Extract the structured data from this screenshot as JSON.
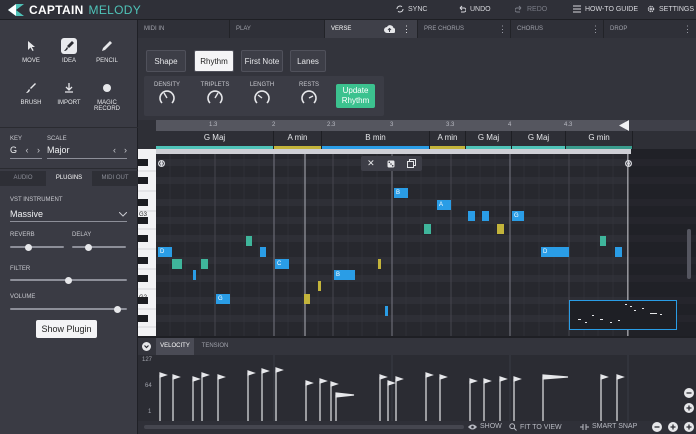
{
  "app": {
    "brand_bold": "CAPTAIN",
    "brand_light": "MELODY"
  },
  "topbar": {
    "sync": "SYNC",
    "undo": "UNDO",
    "redo": "REDO",
    "howto": "HOW-TO GUIDE",
    "settings": "SETTINGS"
  },
  "tools": [
    {
      "label": "MOVE",
      "icon": "cursor-icon"
    },
    {
      "label": "IDEA",
      "icon": "idea-brush-icon"
    },
    {
      "label": "PENCIL",
      "icon": "pencil-icon"
    },
    {
      "label": "BRUSH",
      "icon": "brush-icon"
    },
    {
      "label": "IMPORT",
      "icon": "download-icon"
    },
    {
      "label": "MAGIC",
      "label2": "RECORD",
      "icon": "record-dot-icon"
    }
  ],
  "key": {
    "label": "KEY",
    "value": "G"
  },
  "scale": {
    "label": "SCALE",
    "value": "Major"
  },
  "subtabs": [
    "AUDIO",
    "PLUGINS",
    "MIDI OUT"
  ],
  "plugin": {
    "vst_label": "VST INSTRUMENT",
    "vst_value": "Massive",
    "reverb": "REVERB",
    "delay": "DELAY",
    "filter": "FILTER",
    "volume": "VOLUME",
    "show": "Show Plugin",
    "reverb_level": 0.35,
    "delay_level": 0.3,
    "filter_level": 0.5,
    "volume_level": 0.92
  },
  "tabs": [
    "MIDI IN",
    "PLAY",
    "VERSE",
    "PRE CHORUS",
    "CHORUS",
    "DROP"
  ],
  "mode_buttons": [
    "Shape",
    "Rhythm",
    "First Note",
    "Lanes"
  ],
  "knobs": [
    "DENSITY",
    "TRIPLETS",
    "LENGTH",
    "RESTS"
  ],
  "update_button": {
    "line1": "Update",
    "line2": "Rhythm"
  },
  "ruler": [
    "1.3",
    "2",
    "2.3",
    "3",
    "3.3",
    "4",
    "4.3"
  ],
  "chords": [
    "G Maj",
    "A min",
    "B min",
    "A min",
    "G Maj",
    "G Maj",
    "G min"
  ],
  "key_labels": [
    "G3",
    "G2"
  ],
  "note_labels": [
    "B",
    "A",
    "G",
    "D",
    "C",
    "B",
    "G",
    "D"
  ],
  "velocity": {
    "tabs": [
      "VELOCITY",
      "TENSION"
    ],
    "axis": [
      "127",
      "64",
      "1"
    ]
  },
  "status": {
    "show": "SHOW",
    "fit": "FIT TO VIEW",
    "snap": "SMART SNAP"
  },
  "colors": {
    "accent": "#4fc3b8",
    "blue": "#2a9de6",
    "teal": "#3fb59b",
    "olive": "#c3b43b",
    "update": "#3cc28f"
  }
}
